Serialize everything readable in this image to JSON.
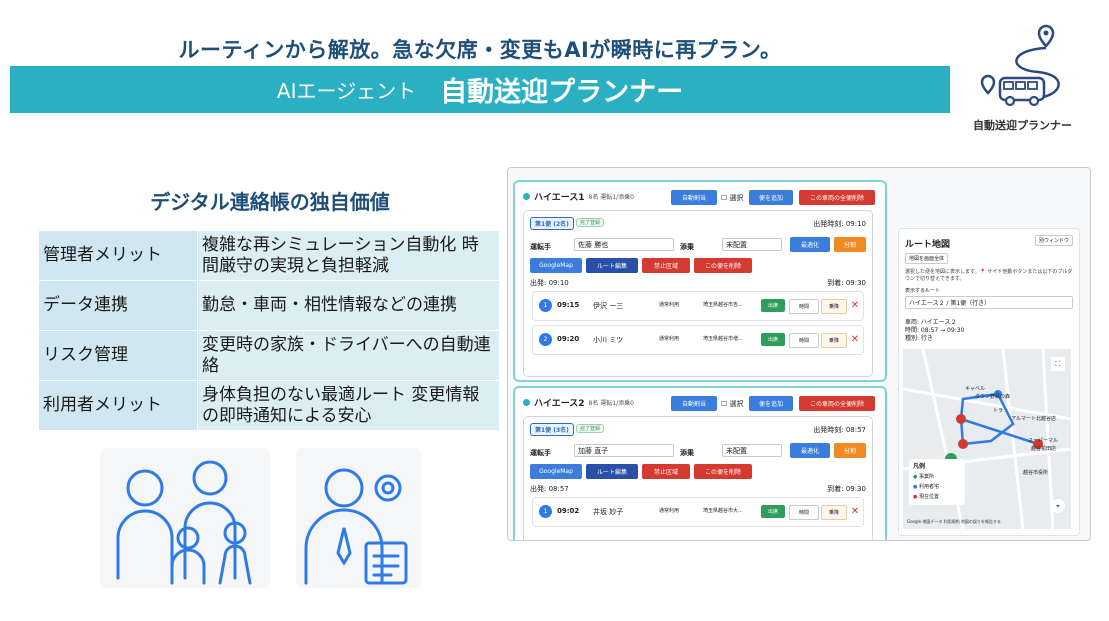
{
  "header": {
    "subtitle": "ルーティンから解放。急な欠席・変更もAIが瞬時に再プラン。",
    "banner_small": "AIエージェント",
    "banner_big": "自動送迎プランナー",
    "logo_caption": "自動送迎プランナー"
  },
  "left": {
    "heading": "デジタル連絡帳の独自価値",
    "rows": [
      {
        "key": "管理者メリット",
        "value": "複雑な再シミュレーション自動化 時間厳守の実現と負担軽減"
      },
      {
        "key": "データ連携",
        "value": "勤怠・車両・相性情報などの連携"
      },
      {
        "key": "リスク管理",
        "value": "変更時の家族・ドライバーへの自動連絡"
      },
      {
        "key": "利用者メリット",
        "value": "身体負担のない最適ルート 変更情報の即時通知による安心"
      }
    ]
  },
  "app": {
    "cards": [
      {
        "vehicle": "ハイエース1",
        "count": "8名 運転1/添乗0",
        "btn_auto": "自動割当",
        "btn_select": "選択",
        "btn_add": "便を追加",
        "btn_delete_all": "この車両の全便削除",
        "trip_tag": "第1便 (2名)",
        "status": "完了登録",
        "departure_time": "出発時刻: 09:10",
        "driver_label": "運転手",
        "driver": "佐藤 勝也",
        "escort_label": "添乗",
        "escort": "未配置",
        "btn_optimize": "最適化",
        "btn_split": "分割",
        "btn_map": "GoogleMap",
        "btn_edit_route": "ルート編集",
        "btn_forbid": "禁止区域",
        "btn_delete_trip": "この便を削除",
        "depart": "出発: 09:10",
        "arrive": "到着: 09:30",
        "stops": [
          {
            "n": "1",
            "time": "09:15",
            "name": "伊沢 一三",
            "type": "通常利用",
            "addr": "埼玉県越谷市吉...",
            "attend": "出席",
            "time_btn": "時間",
            "ride": "乗降"
          },
          {
            "n": "2",
            "time": "09:20",
            "name": "小川 ミツ",
            "type": "通常利用",
            "addr": "埼玉県越谷市増...",
            "attend": "出席",
            "time_btn": "時間",
            "ride": "乗降"
          }
        ]
      },
      {
        "vehicle": "ハイエース2",
        "count": "8名 運転1/添乗0",
        "btn_auto": "自動割当",
        "btn_select": "選択",
        "btn_add": "便を追加",
        "btn_delete_all": "この車両の全便削除",
        "trip_tag": "第1便 (3名)",
        "status": "完了登録",
        "departure_time": "出発時刻: 08:57",
        "driver_label": "運転手",
        "driver": "加藤 直子",
        "escort_label": "添乗",
        "escort": "未配置",
        "btn_optimize": "最適化",
        "btn_split": "分割",
        "btn_map": "GoogleMap",
        "btn_edit_route": "ルート編集",
        "btn_forbid": "禁止区域",
        "btn_delete_trip": "この便を削除",
        "depart": "出発: 08:57",
        "arrive": "到着: 09:30",
        "stops": [
          {
            "n": "1",
            "time": "09:02",
            "name": "井坂 妙子",
            "type": "通常利用",
            "addr": "埼玉県越谷市大...",
            "attend": "出席",
            "time_btn": "時間",
            "ride": "乗降"
          }
        ]
      }
    ],
    "map": {
      "title": "ルート地図",
      "open_window": "別ウィンドウ",
      "fit_button": "地図を画面全体",
      "hint": "選択した便を地図に表示します。📍 サイド他動ボタンまたは以下のプルダウンで切り替えできます。",
      "route_label": "表示するルート",
      "route_value": "ハイエース２ / 第1便（行き）",
      "info_vehicle": "車両: ハイエース２",
      "info_time": "時間: 08:57 → 09:30",
      "info_type": "種別: 行き",
      "legend_title": "凡例",
      "legend": [
        {
          "label": "事業所",
          "color": "#2e9e5a"
        },
        {
          "label": "利用者宅",
          "color": "#2f7ae5"
        },
        {
          "label": "現在位置",
          "color": "#d43a2f"
        }
      ],
      "places": [
        "キャベル",
        "トラ",
        "アルマート北越谷店",
        "スーパーマル",
        "越谷花田店",
        "ダウン野鳥の森",
        "越谷市役所"
      ],
      "footer": "Google 地図データ 利用規約 地図の誤りを報告する"
    }
  }
}
